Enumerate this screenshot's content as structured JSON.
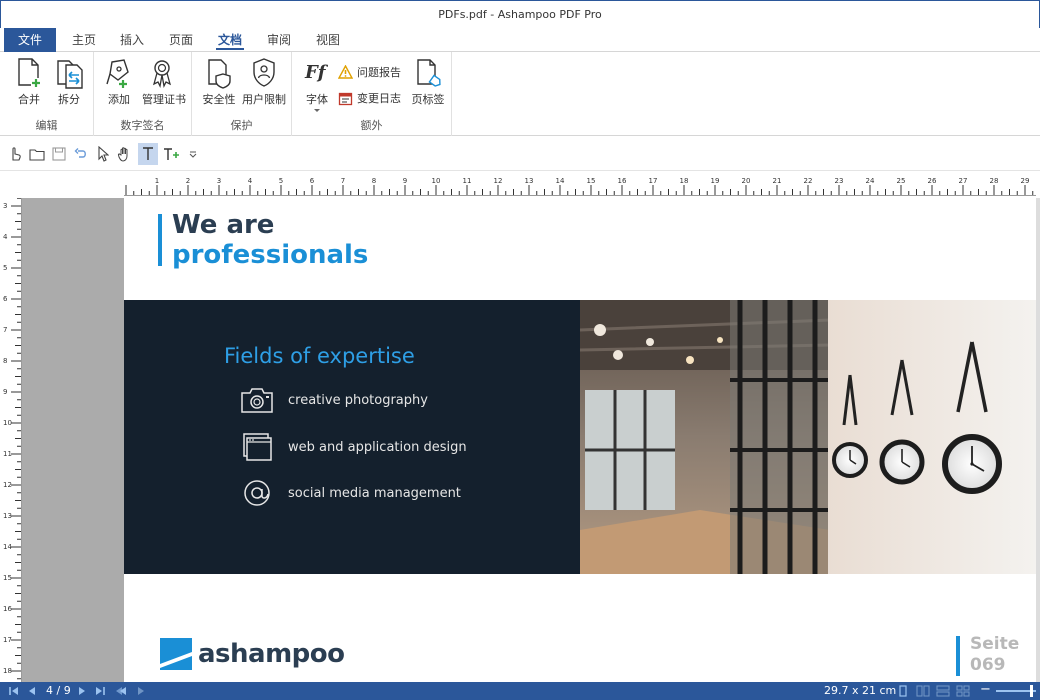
{
  "window": {
    "title": "PDFs.pdf - Ashampoo PDF Pro"
  },
  "menu": {
    "tabs": [
      {
        "label": "文件"
      },
      {
        "label": "主页"
      },
      {
        "label": "插入"
      },
      {
        "label": "页面"
      },
      {
        "label": "文档"
      },
      {
        "label": "审阅"
      },
      {
        "label": "视图"
      }
    ],
    "active": "文档"
  },
  "ribbon": {
    "groups": {
      "edit": {
        "label": "编辑",
        "merge": "合并",
        "split": "拆分"
      },
      "signature": {
        "label": "数字签名",
        "add": "添加",
        "manage_cert": "管理证书"
      },
      "protect": {
        "label": "保护",
        "security": "安全性",
        "user_limit": "用户限制"
      },
      "extra": {
        "label": "额外",
        "fonts": "字体",
        "problem_report": "问题报告",
        "change_log": "变更日志",
        "bookmarks": "页标签"
      }
    }
  },
  "ruler": {
    "h_labels": [
      "1",
      "2",
      "3",
      "4",
      "5",
      "6",
      "7",
      "8",
      "9",
      "10",
      "11",
      "12",
      "13",
      "14",
      "15",
      "16",
      "17",
      "18",
      "19",
      "20",
      "21",
      "22",
      "23",
      "24",
      "25",
      "26",
      "27",
      "28",
      "29"
    ],
    "v_labels": [
      "3",
      "4",
      "5",
      "6",
      "7",
      "8",
      "9",
      "10",
      "11",
      "12",
      "13",
      "14",
      "15",
      "16",
      "17",
      "18"
    ]
  },
  "document": {
    "headline_1": "We are",
    "headline_2": "professionals",
    "fields_title": "Fields of expertise",
    "fields": [
      {
        "icon": "camera-icon",
        "label": "creative photography"
      },
      {
        "icon": "browser-window-icon",
        "label": "web and application design"
      },
      {
        "icon": "at-sign-icon",
        "label": "social media management"
      }
    ],
    "logo_text": "ashampoo",
    "page_label": "Seite",
    "page_number": "069"
  },
  "status": {
    "page_indicator": "4 / 9",
    "page_size": "29.7 x 21 cm",
    "zoom_minus": "−"
  },
  "colors": {
    "accent": "#2b579a",
    "brand_blue": "#1a8fd6",
    "dark_panel": "#14202d",
    "headline_dark": "#2b3e52"
  }
}
